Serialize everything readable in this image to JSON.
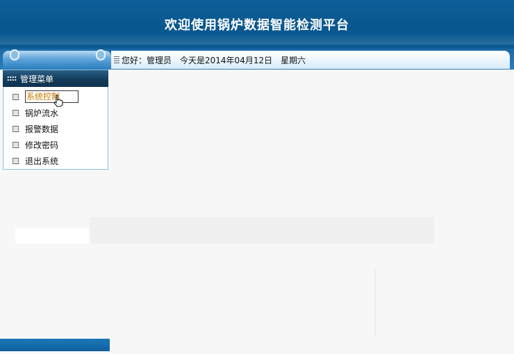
{
  "header": {
    "title": "欢迎使用锅炉数据智能检测平台"
  },
  "topbar": {
    "greeting": "您好：管理员",
    "date_text": "今天是2014年04月12日",
    "weekday": "星期六"
  },
  "menu": {
    "title": "管理菜单",
    "items": [
      {
        "label": "系统控制"
      },
      {
        "label": "锅炉流水"
      },
      {
        "label": "报警数据"
      },
      {
        "label": "修改密码"
      },
      {
        "label": "退出系统"
      }
    ],
    "active_index": 0
  },
  "colors": {
    "header_bg": "#0a578f",
    "active_item_text": "#c87a00",
    "menu_header_bg": "#123a57"
  }
}
